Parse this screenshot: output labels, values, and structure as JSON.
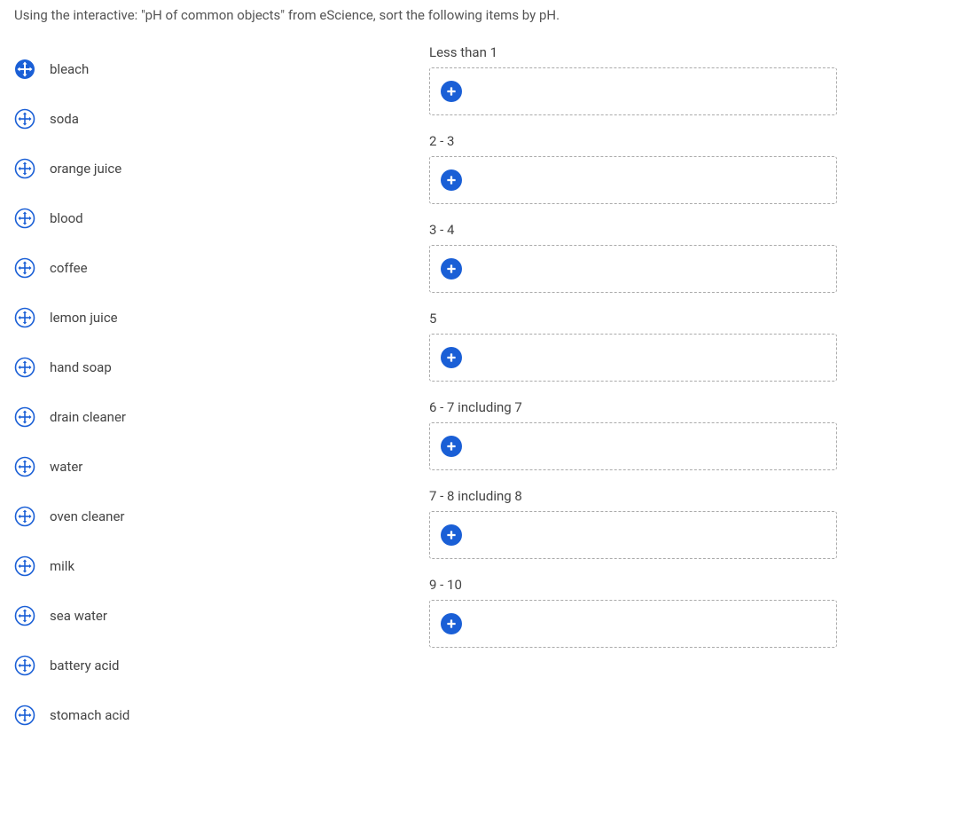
{
  "prompt": "Using the interactive: \"pH of common objects\" from eScience, sort the following items by pH.",
  "items": [
    {
      "label": "bleach",
      "icon_style": "filled"
    },
    {
      "label": "soda",
      "icon_style": "outline"
    },
    {
      "label": "orange juice",
      "icon_style": "outline"
    },
    {
      "label": "blood",
      "icon_style": "outline"
    },
    {
      "label": "coffee",
      "icon_style": "outline"
    },
    {
      "label": "lemon juice",
      "icon_style": "outline"
    },
    {
      "label": "hand soap",
      "icon_style": "outline"
    },
    {
      "label": "drain cleaner",
      "icon_style": "outline"
    },
    {
      "label": "water",
      "icon_style": "outline"
    },
    {
      "label": "oven cleaner",
      "icon_style": "outline"
    },
    {
      "label": "milk",
      "icon_style": "outline"
    },
    {
      "label": "sea water",
      "icon_style": "outline"
    },
    {
      "label": "battery acid",
      "icon_style": "outline"
    },
    {
      "label": "stomach acid",
      "icon_style": "outline"
    }
  ],
  "categories": [
    {
      "label": "Less than 1"
    },
    {
      "label": "2 - 3"
    },
    {
      "label": "3 - 4"
    },
    {
      "label": "5"
    },
    {
      "label": "6 - 7 including 7"
    },
    {
      "label": "7 - 8 including 8"
    },
    {
      "label": "9 - 10"
    }
  ]
}
